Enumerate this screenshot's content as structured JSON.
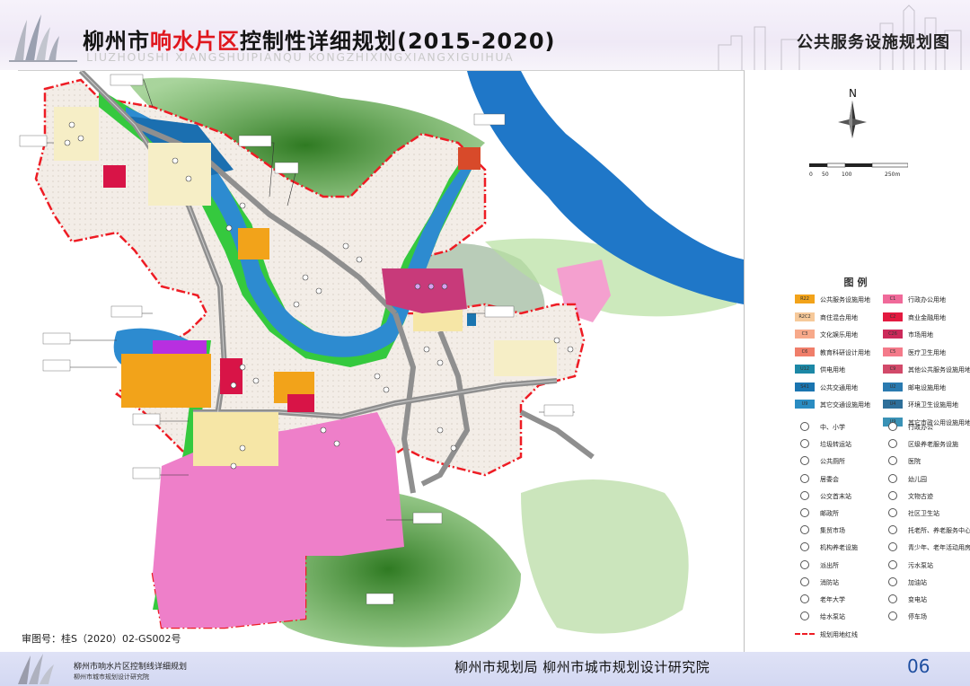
{
  "header": {
    "title_prefix": "柳州市",
    "title_highlight": "响水片区",
    "title_suffix": "控制性详细规划(2015-2020)",
    "pinyin": "LIUZHOUSHI  XIANGSHUIPIANQU  KONGZHIXINGXIANGXIGUIHUA",
    "sheet_title": "公共服务设施规划图"
  },
  "map": {
    "approval_no": "审图号：桂S（2020）02-GS002号",
    "north_label": "N",
    "scale_labels": [
      "0",
      "50",
      "100",
      "250m"
    ],
    "colors": {
      "river": "#1f77c8",
      "green": "#2fc43c",
      "hill": "#3d8a2c",
      "residential": "#f2ece6",
      "pink": "#ef7fc8",
      "orange": "#f2a31a",
      "red": "#d81447",
      "purple": "#b82fe0",
      "boundary": "#ee1c24"
    }
  },
  "legend": {
    "title": "图例",
    "left_items": [
      {
        "code": "R22",
        "label": "公共服务设施用地",
        "color": "#f2a31a"
      },
      {
        "code": "R2C2",
        "label": "商住混合用地",
        "color": "#f6c99a"
      },
      {
        "code": "C3",
        "label": "文化娱乐用地",
        "color": "#f7a98a"
      },
      {
        "code": "C6",
        "label": "教育科研设计用地",
        "color": "#f07e6a"
      },
      {
        "code": "U12",
        "label": "供电用地",
        "color": "#1c88a6"
      },
      {
        "code": "S41",
        "label": "公共交通用地",
        "color": "#1a75b0"
      },
      {
        "code": "U9",
        "label": "其它交通设施用地",
        "color": "#2a8cc2"
      }
    ],
    "right_items": [
      {
        "code": "C1",
        "label": "行政办公用地",
        "color": "#f06a9a"
      },
      {
        "code": "C2",
        "label": "商业金融用地",
        "color": "#e31a40"
      },
      {
        "code": "C26",
        "label": "市场用地",
        "color": "#cc2a5a"
      },
      {
        "code": "C5",
        "label": "医疗卫生用地",
        "color": "#f47a8a"
      },
      {
        "code": "C9",
        "label": "其他公共服务设施用地",
        "color": "#d24a6a"
      },
      {
        "code": "U2",
        "label": "邮电设施用地",
        "color": "#2a7ab0"
      },
      {
        "code": "U4",
        "label": "环境卫生设施用地",
        "color": "#2e6f9a"
      },
      {
        "code": "U9",
        "label": "其它市政公用设施用地",
        "color": "#3a92b6"
      }
    ],
    "left_symbols": [
      "中、小学",
      "垃圾转运站",
      "公共厕所",
      "居委会",
      "公交首末站",
      "邮政所",
      "集贸市场",
      "机构养老设施",
      "派出所",
      "消防站",
      "老年大学",
      "给水泵站"
    ],
    "right_symbols": [
      "行政办公",
      "区级养老服务设施",
      "医院",
      "幼儿园",
      "文物古迹",
      "社区卫生站",
      "托老所、养老服务中心",
      "青少年、老年活动用房",
      "污水泵站",
      "加油站",
      "变电站",
      "停车场"
    ],
    "boundary_label": "规划用地红线"
  },
  "footer": {
    "project_name": "柳州市响水片区控制线详细规划",
    "institute_small": "柳州市城市规划设计研究院",
    "orgs": "柳州市规划局    柳州市城市规划设计研究院",
    "page_no": "06"
  }
}
